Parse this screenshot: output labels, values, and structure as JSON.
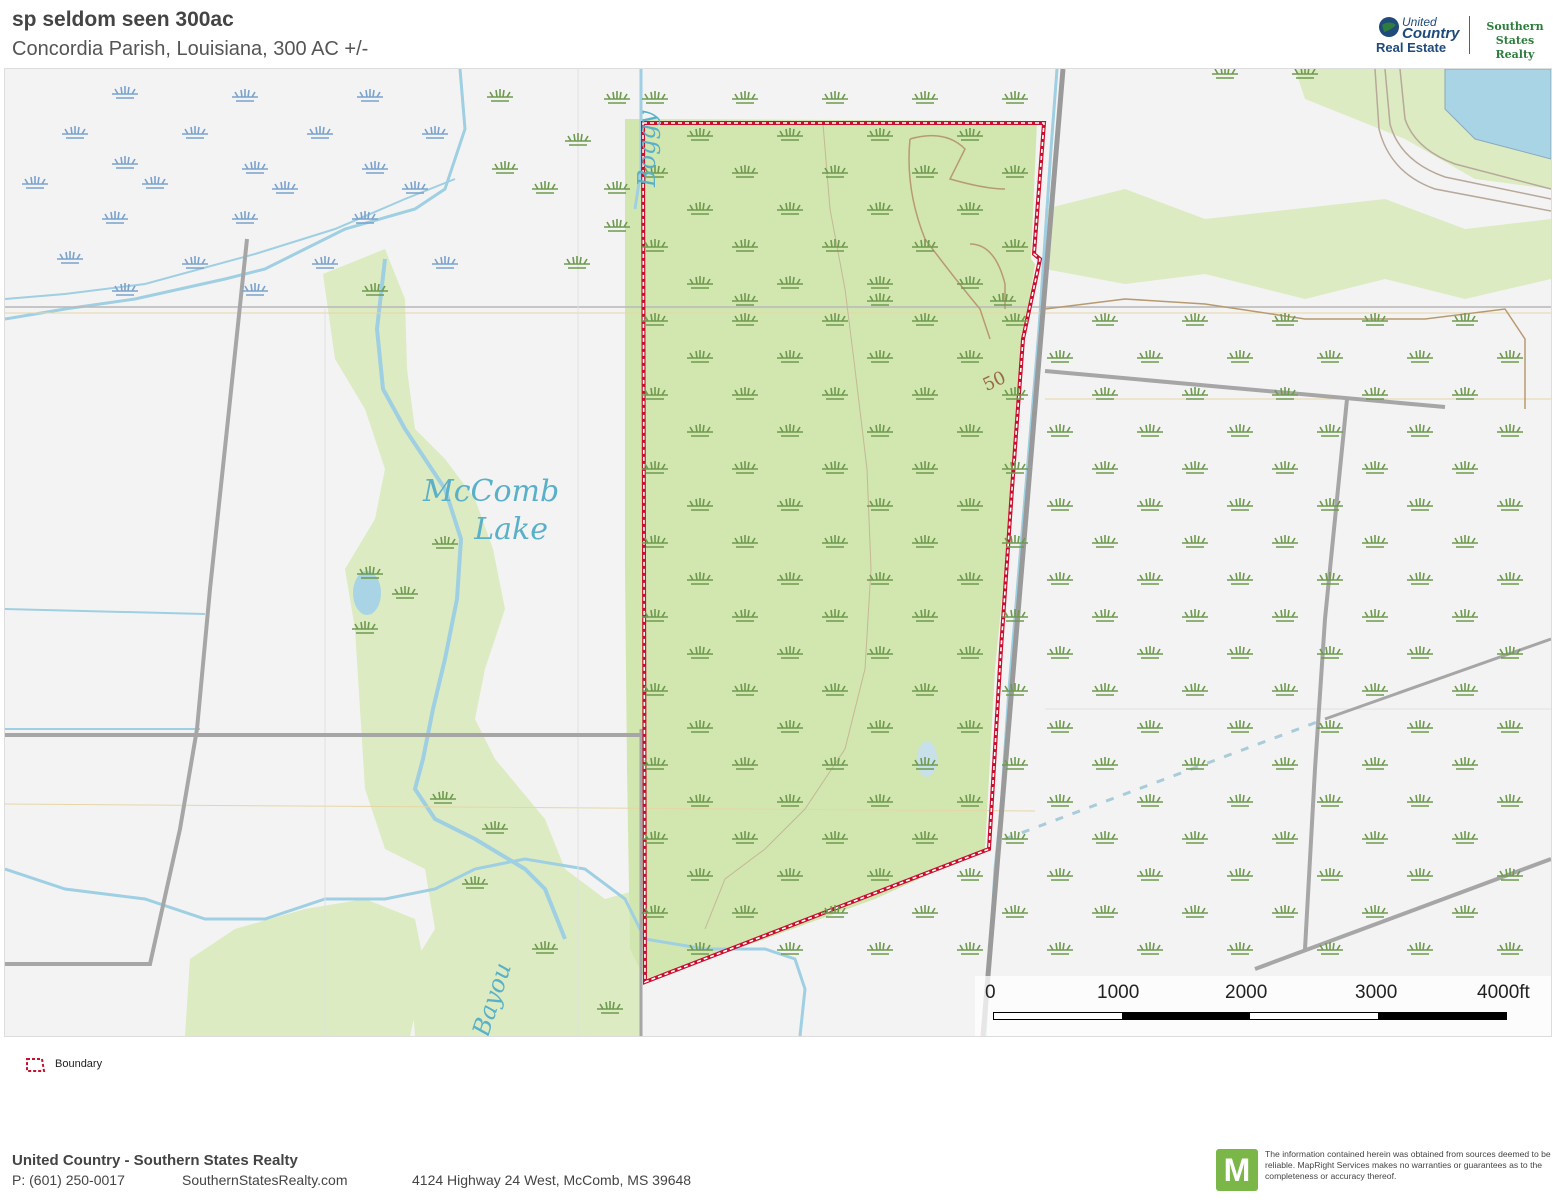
{
  "header": {
    "title": "sp seldom seen 300ac",
    "subtitle": "Concordia Parish, Louisiana, 300 AC +/-"
  },
  "logo": {
    "united": "United",
    "country": "Country",
    "real_estate": "Real Estate",
    "southern_states_realty": "Southern States Realty"
  },
  "map": {
    "labels": {
      "mccomb_line1": "McComb",
      "mccomb_line2": "Lake",
      "boggy": "Boggy",
      "bayou": "Bayou",
      "contour": "50"
    },
    "colors": {
      "background": "#f3f3f3",
      "wetland_green": "#dcebc2",
      "water": "#a8d4e6",
      "road": "#a6a6a6",
      "boundary": "#c8102e",
      "marsh_symbol_green": "#6e9a4e",
      "marsh_symbol_blue": "#7ba2cc"
    }
  },
  "scale": {
    "ticks": [
      "0",
      "1000",
      "2000",
      "3000",
      "4000ft"
    ]
  },
  "legend": {
    "boundary_label": "Boundary"
  },
  "footer": {
    "company": "United Country - Southern States Realty",
    "phone": "P: (601) 250-0017",
    "website": "SouthernStatesRealty.com",
    "address": "4124 Highway 24 West, McComb, MS 39648",
    "mapright_letter": "M",
    "disclaimer": "The information contained herein was obtained from sources deemed to be reliable. MapRight Services makes no warranties or guarantees as to the completeness or accuracy thereof."
  }
}
